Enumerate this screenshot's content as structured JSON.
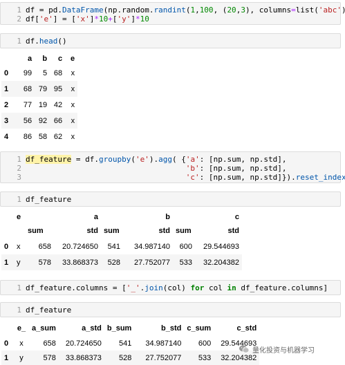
{
  "cells": [
    {
      "lines": [
        "1",
        "2"
      ],
      "code": [
        [
          [
            "plain",
            "df = pd."
          ],
          [
            "attr",
            "DataFrame"
          ],
          [
            "plain",
            "(np.random."
          ],
          [
            "attr",
            "randint"
          ],
          [
            "plain",
            "("
          ],
          [
            "num",
            "1"
          ],
          [
            "plain",
            ","
          ],
          [
            "num",
            "100"
          ],
          [
            "plain",
            ", ("
          ],
          [
            "num",
            "20"
          ],
          [
            "plain",
            ","
          ],
          [
            "num",
            "3"
          ],
          [
            "plain",
            "), columns"
          ],
          [
            "op",
            "="
          ],
          [
            "plain",
            "list("
          ],
          [
            "str",
            "'abc'"
          ],
          [
            "plain",
            "))"
          ]
        ],
        [
          [
            "plain",
            "df["
          ],
          [
            "str",
            "'e'"
          ],
          [
            "plain",
            "] = ["
          ],
          [
            "str",
            "'x'"
          ],
          [
            "plain",
            "]"
          ],
          [
            "op",
            "*"
          ],
          [
            "num",
            "10"
          ],
          [
            "op",
            "+"
          ],
          [
            "plain",
            "["
          ],
          [
            "str",
            "'y'"
          ],
          [
            "plain",
            "]"
          ],
          [
            "op",
            "*"
          ],
          [
            "num",
            "10"
          ]
        ]
      ]
    },
    {
      "lines": [
        "1"
      ],
      "code": [
        [
          [
            "plain",
            "df."
          ],
          [
            "attr",
            "head"
          ],
          [
            "plain",
            "()"
          ]
        ]
      ]
    },
    {
      "lines": [
        "1",
        "2",
        "3"
      ],
      "code": [
        [
          [
            "hl",
            "df_feature"
          ],
          [
            "plain",
            " = df."
          ],
          [
            "attr",
            "groupby"
          ],
          [
            "plain",
            "("
          ],
          [
            "str",
            "'e'"
          ],
          [
            "plain",
            ")."
          ],
          [
            "attr",
            "agg"
          ],
          [
            "plain",
            "( {"
          ],
          [
            "str",
            "'a'"
          ],
          [
            "plain",
            ": [np.sum, np.std],"
          ]
        ],
        [
          [
            "plain",
            "                                   "
          ],
          [
            "str",
            "'b'"
          ],
          [
            "plain",
            ": [np.sum, np.std],"
          ]
        ],
        [
          [
            "plain",
            "                                   "
          ],
          [
            "str",
            "'c'"
          ],
          [
            "plain",
            ": [np.sum, np.std]})."
          ],
          [
            "attr",
            "reset_index"
          ],
          [
            "plain",
            "()"
          ]
        ]
      ]
    },
    {
      "lines": [
        "1"
      ],
      "code": [
        [
          [
            "plain",
            "df_feature"
          ]
        ]
      ]
    },
    {
      "lines": [
        "1"
      ],
      "code": [
        [
          [
            "plain",
            "df_feature.columns = ["
          ],
          [
            "str",
            "'_'"
          ],
          [
            "plain",
            "."
          ],
          [
            "attr",
            "join"
          ],
          [
            "plain",
            "(col) "
          ],
          [
            "kw",
            "for"
          ],
          [
            "plain",
            " col "
          ],
          [
            "kw",
            "in"
          ],
          [
            "plain",
            " df_feature.columns]"
          ]
        ]
      ]
    },
    {
      "lines": [
        "1"
      ],
      "code": [
        [
          [
            "plain",
            "df_feature"
          ]
        ]
      ]
    }
  ],
  "head_table": {
    "columns": [
      "a",
      "b",
      "c",
      "e"
    ],
    "rows": [
      {
        "index": "0",
        "values": [
          "99",
          "5",
          "68",
          "x"
        ]
      },
      {
        "index": "1",
        "values": [
          "68",
          "79",
          "95",
          "x"
        ]
      },
      {
        "index": "2",
        "values": [
          "77",
          "19",
          "42",
          "x"
        ]
      },
      {
        "index": "3",
        "values": [
          "56",
          "92",
          "66",
          "x"
        ]
      },
      {
        "index": "4",
        "values": [
          "86",
          "58",
          "62",
          "x"
        ]
      }
    ]
  },
  "feature_table": {
    "level0": [
      "e",
      "a",
      "b",
      "c"
    ],
    "level1": [
      "sum",
      "std",
      "sum",
      "std",
      "sum",
      "std"
    ],
    "rows": [
      {
        "index": "0",
        "values": [
          "x",
          "658",
          "20.724650",
          "541",
          "34.987140",
          "600",
          "29.544693"
        ]
      },
      {
        "index": "1",
        "values": [
          "y",
          "578",
          "33.868373",
          "528",
          "27.752077",
          "533",
          "32.204382"
        ]
      }
    ]
  },
  "flat_table": {
    "columns": [
      "e_",
      "a_sum",
      "a_std",
      "b_sum",
      "b_std",
      "c_sum",
      "c_std"
    ],
    "rows": [
      {
        "index": "0",
        "values": [
          "x",
          "658",
          "20.724650",
          "541",
          "34.987140",
          "600",
          "29.544693"
        ]
      },
      {
        "index": "1",
        "values": [
          "y",
          "578",
          "33.868373",
          "528",
          "27.752077",
          "533",
          "32.204382"
        ]
      }
    ]
  },
  "watermark": {
    "text": "量化投资与机器学习",
    "icon": "wechat-logo-icon"
  },
  "colors": {
    "string": "#ba2121",
    "keyword": "#008000",
    "attr": "#0055aa",
    "highlight": "#fff3a8",
    "cell_bg": "#f5f5f5"
  }
}
